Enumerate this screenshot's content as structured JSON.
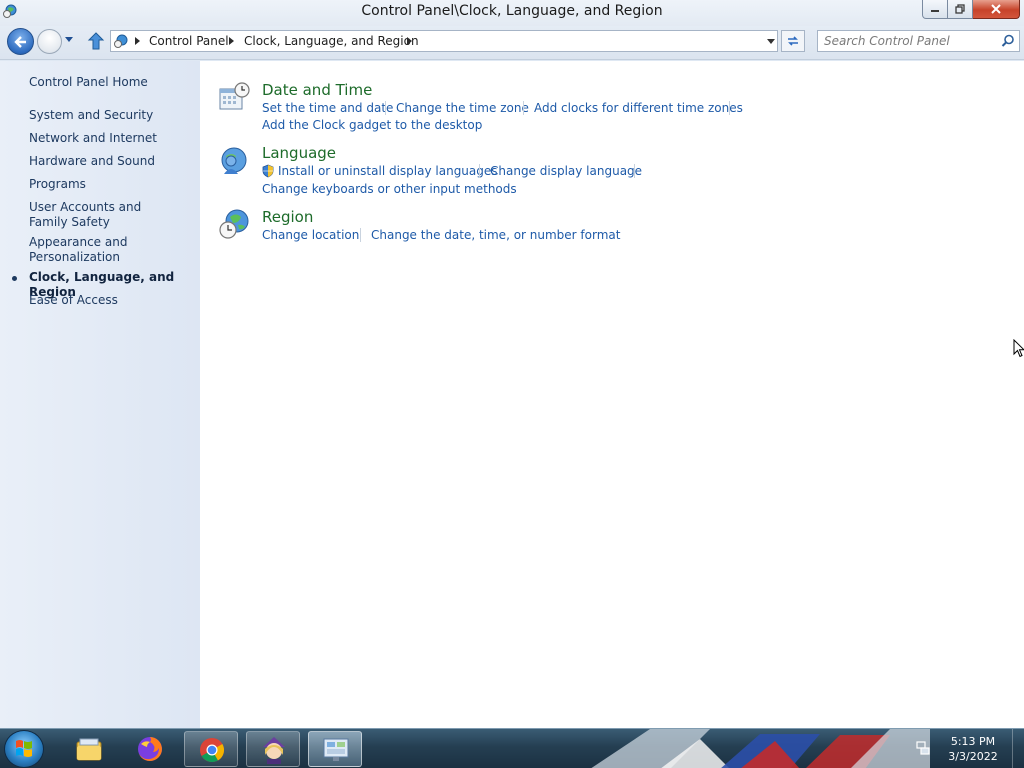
{
  "window": {
    "title": "Control Panel\\Clock, Language, and Region"
  },
  "navigation": {
    "breadcrumbs": [
      "Control Panel",
      "Clock, Language, and Region"
    ],
    "search_placeholder": "Search Control Panel"
  },
  "sidebar": {
    "items": [
      {
        "label": "Control Panel Home"
      },
      {
        "label": "System and Security"
      },
      {
        "label": "Network and Internet"
      },
      {
        "label": "Hardware and Sound"
      },
      {
        "label": "Programs"
      },
      {
        "label": "User Accounts and Family Safety"
      },
      {
        "label": "Appearance and Personalization"
      },
      {
        "label": "Clock, Language, and Region",
        "active": true
      },
      {
        "label": "Ease of Access"
      }
    ]
  },
  "categories": [
    {
      "title": "Date and Time",
      "icon": "calendar-clock-icon",
      "links": [
        "Set the time and date",
        "Change the time zone",
        "Add clocks for different time zones",
        "Add the Clock gadget to the desktop"
      ]
    },
    {
      "title": "Language",
      "icon": "language-icon",
      "links": [
        "Install or uninstall display languages",
        "Change display language",
        "Change keyboards or other input methods"
      ]
    },
    {
      "title": "Region",
      "icon": "globe-clock-icon",
      "links": [
        "Change location",
        "Change the date, time, or number format"
      ]
    }
  ],
  "taskbar": {
    "apps": [
      "file-explorer-icon",
      "firefox-icon",
      "chrome-icon",
      "character-app-icon",
      "control-panel-icon"
    ],
    "clock_time": "5:13 PM",
    "clock_date": "3/3/2022"
  },
  "colors": {
    "category_title": "#1d6b2a",
    "link": "#1e5aa8",
    "sidebar_text": "#1e3a60"
  }
}
